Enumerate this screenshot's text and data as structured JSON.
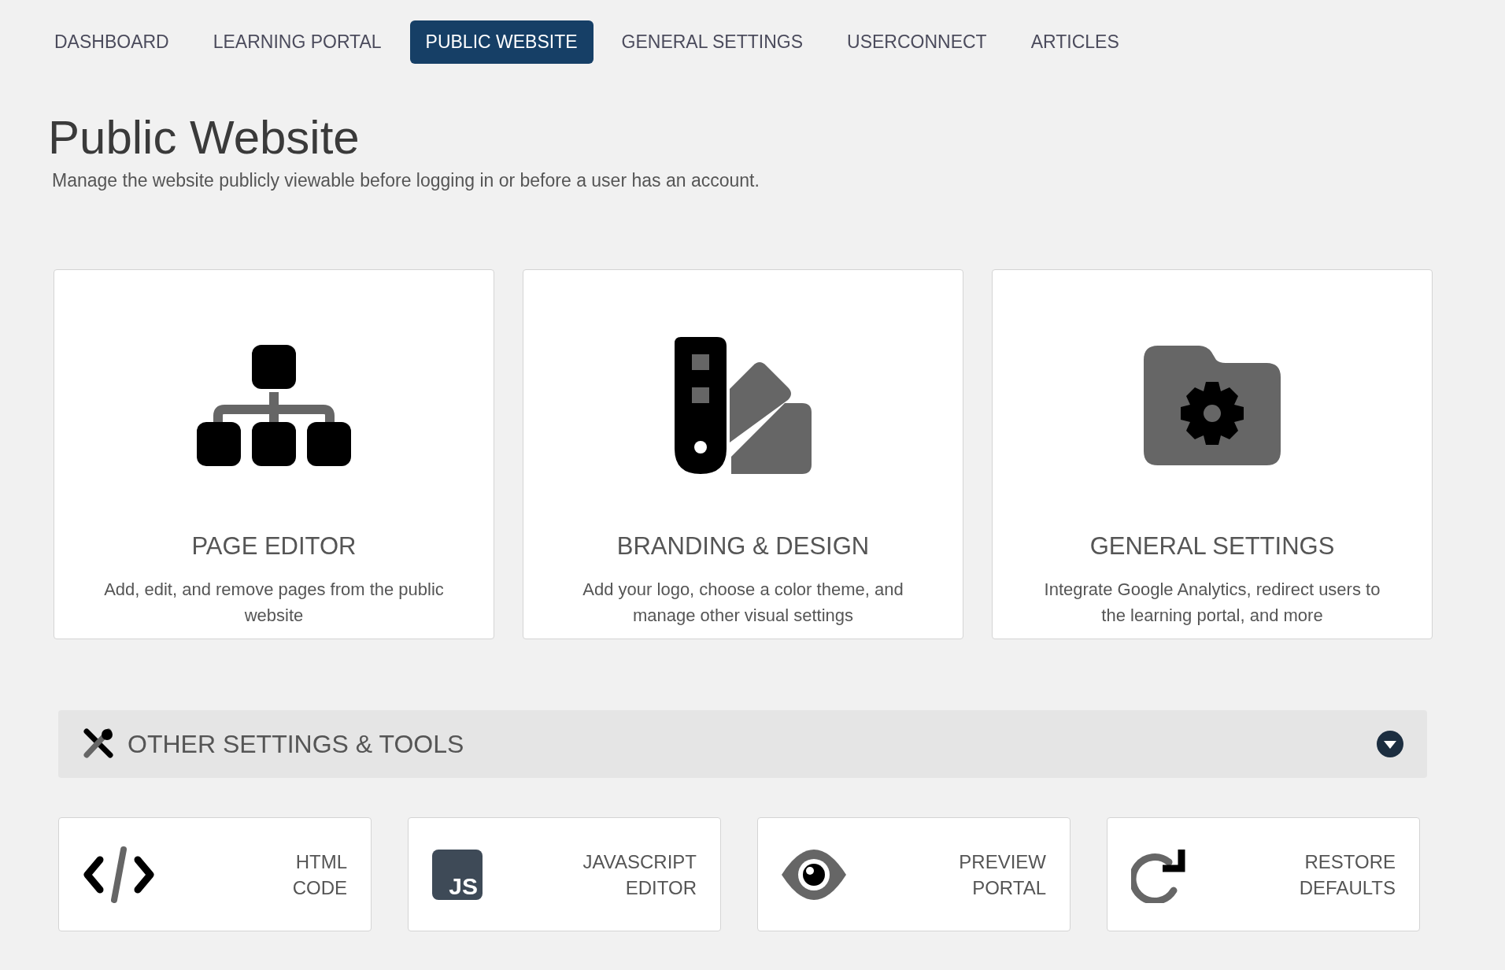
{
  "nav_tabs": [
    {
      "label": "DASHBOARD",
      "selected": false
    },
    {
      "label": "LEARNING PORTAL",
      "selected": false
    },
    {
      "label": "PUBLIC WEBSITE",
      "selected": true
    },
    {
      "label": "GENERAL SETTINGS",
      "selected": false
    },
    {
      "label": "USERCONNECT",
      "selected": false
    },
    {
      "label": "ARTICLES",
      "selected": false
    }
  ],
  "page": {
    "title": "Public Website",
    "subtitle": "Manage the website publicly viewable before logging in or before a user has an account."
  },
  "cards": [
    {
      "kind": "sitemap",
      "title": "PAGE EDITOR",
      "description": "Add, edit, and remove pages from the public website"
    },
    {
      "kind": "swatch",
      "title": "BRANDING & DESIGN",
      "description": "Add your logo, choose a color theme, and manage other visual settings"
    },
    {
      "kind": "folder",
      "title": "GENERAL SETTINGS",
      "description": "Integrate Google Analytics, redirect users to the learning portal, and more"
    }
  ],
  "other_settings": {
    "title": "OTHER SETTINGS & TOOLS"
  },
  "tools": [
    {
      "kind": "code",
      "label": "HTML\nCODE"
    },
    {
      "kind": "js",
      "icon_text": "JS",
      "label": "JAVASCRIPT\nEDITOR"
    },
    {
      "kind": "eye",
      "label": "PREVIEW\nPORTAL"
    },
    {
      "kind": "restore",
      "label": "RESTORE\nDEFAULTS"
    }
  ]
}
